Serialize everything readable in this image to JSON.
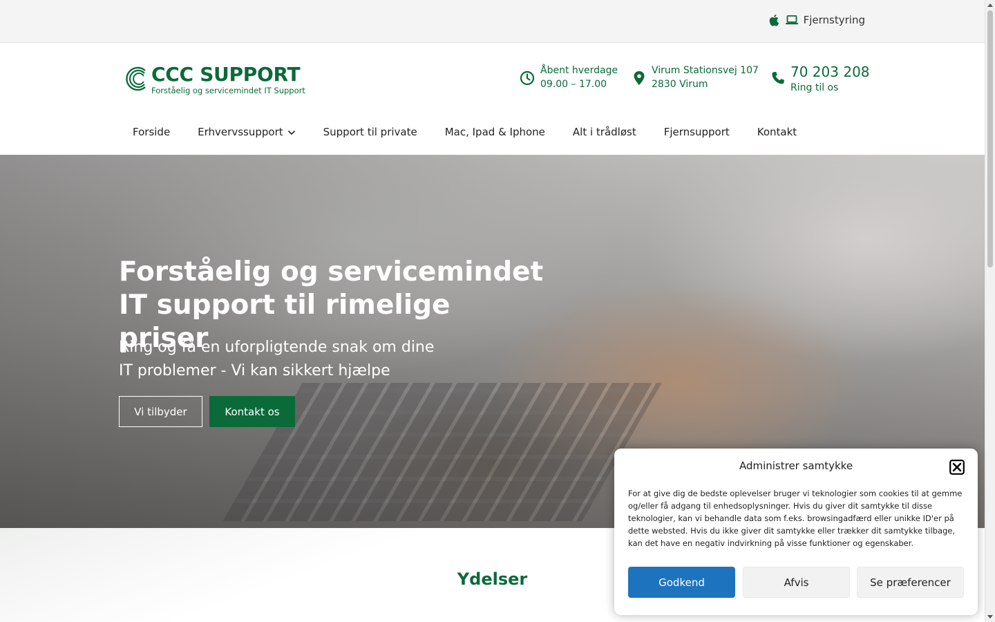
{
  "topbar": {
    "remote_label": "Fjernstyring",
    "icons": [
      "apple-icon",
      "laptop-icon"
    ]
  },
  "logo": {
    "name": "CCC SUPPORT",
    "tagline": "Forståelig og servicemindet IT Support"
  },
  "contact": {
    "hours_title": "Åbent hverdage",
    "hours_value": "09.00 – 17.00",
    "address_line1": "Virum Stationsvej 107",
    "address_line2": "2830 Virum",
    "phone": "70 203 208",
    "phone_caption": "Ring til os"
  },
  "nav": {
    "items": [
      {
        "label": "Forside"
      },
      {
        "label": "Erhvervssupport",
        "has_dropdown": true
      },
      {
        "label": "Support til private"
      },
      {
        "label": "Mac, Ipad & Iphone"
      },
      {
        "label": "Alt i trådløst"
      },
      {
        "label": "Fjernsupport"
      },
      {
        "label": "Kontakt"
      }
    ]
  },
  "hero": {
    "heading_line1": "Forståelig og servicemindet",
    "heading_line2": "IT support til rimelige priser",
    "sub_line1": "Ring og få en uforpligtende snak om dine",
    "sub_line2": "IT problemer - Vi kan sikkert hjælpe",
    "primary_button": "Vi tilbyder",
    "secondary_button": "Kontakt os"
  },
  "section": {
    "title": "Ydelser"
  },
  "consent": {
    "title": "Administrer samtykke",
    "body": "For at give dig de bedste oplevelser bruger vi teknologier som cookies til at gemme og/eller få adgang til enhedsoplysninger. Hvis du giver dit samtykke til disse teknologier, kan vi behandle data som f.eks. browsingadfærd eller unikke ID'er på dette websted. Hvis du ikke giver dit samtykke eller trækker dit samtykke tilbage, kan det have en negativ indvirkning på visse funktioner og egenskaber.",
    "accept": "Godkend",
    "deny": "Afvis",
    "preferences": "Se præferencer"
  },
  "colors": {
    "brand_green": "#0b6a3a",
    "accept_blue": "#1e73be"
  }
}
